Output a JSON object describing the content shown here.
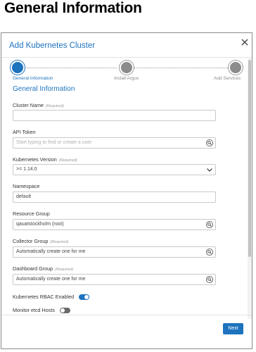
{
  "page": {
    "heading": "General Information"
  },
  "modal": {
    "title": "Add Kubernetes Cluster",
    "section_title": "General Information",
    "steps": [
      {
        "label": "General Information",
        "state": "active"
      },
      {
        "label": "Install Argus",
        "state": "pending"
      },
      {
        "label": "Add Services",
        "state": "pending"
      }
    ],
    "required_tag": "(Required)",
    "fields": {
      "cluster_name": {
        "label": "Cluster Name",
        "value": ""
      },
      "api_token": {
        "label": "API Token",
        "placeholder": "Start typing to find or create a user"
      },
      "kubernetes_version": {
        "label": "Kubernetes Version",
        "value": ">= 1.14.0"
      },
      "namespace": {
        "label": "Namespace",
        "value": "default"
      },
      "resource_group": {
        "label": "Resource Group",
        "value": "qauatstockholm (root)"
      },
      "collector_group": {
        "label": "Collector Group",
        "value": "Automatically create one for me"
      },
      "dashboard_group": {
        "label": "Dashboard Group",
        "value": "Automatically create one for me"
      }
    },
    "toggles": {
      "rbac": {
        "label": "Kubernetes RBAC Enabled",
        "state": "on"
      },
      "etcd": {
        "label": "Monitor etcd Hosts",
        "state": "off"
      }
    },
    "next_label": "Next"
  },
  "colors": {
    "accent": "#1e73be",
    "step_pending": "#8c8c8c"
  },
  "icons": {
    "close": "close-icon",
    "search": "search-icon",
    "chevron": "chevron-down-icon"
  }
}
